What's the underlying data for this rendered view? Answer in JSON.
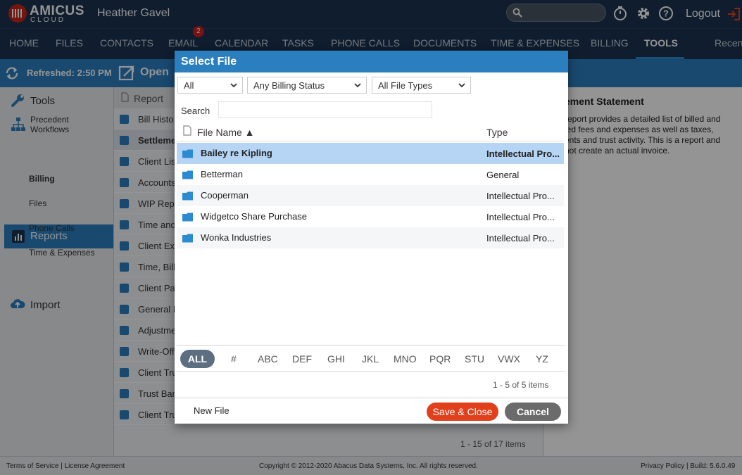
{
  "header": {
    "logo_main": "AMICUS",
    "logo_sub": "CLOUD",
    "user_name": "Heather Gavel",
    "logout_label": "Logout"
  },
  "nav": {
    "items": [
      "HOME",
      "FILES",
      "CONTACTS",
      "EMAIL",
      "CALENDAR",
      "TASKS",
      "PHONE CALLS",
      "DOCUMENTS",
      "TIME & EXPENSES",
      "BILLING",
      "TOOLS",
      "Recen"
    ],
    "active": "TOOLS",
    "email_badge": "2"
  },
  "subbar": {
    "refreshed": "Refreshed: 2:50 PM",
    "open_label": "Open"
  },
  "sidebar": {
    "tools": "Tools",
    "precedent_workflows": "Precedent Workflows",
    "reports": "Reports",
    "sub_items": [
      "Billing",
      "Files",
      "Phone Calls",
      "Time & Expenses"
    ],
    "import": "Import"
  },
  "report_list": {
    "header": "Report",
    "rows": [
      "Bill Histo",
      "Settleme",
      "Client Lis",
      "Accounts",
      "WIP Repo",
      "Time and",
      "Client Exp",
      "Time, Bill",
      "Client Pa",
      "General E",
      "Adjustme",
      "Write-Off",
      "Client Tru",
      "Trust Bar",
      "Client Tru"
    ],
    "footer": "1 - 15 of 17 items"
  },
  "detail": {
    "title": "ement Statement",
    "lines": [
      "report provides a detailed list of billed and",
      "led fees and expenses as well as taxes,",
      "ents and trust activity.  This is a report and",
      "not create an actual invoice."
    ]
  },
  "footer": {
    "left": "Terms of Service | License Agreement",
    "center": "Copyright © 2012-2020 Abacus Data Systems, Inc. All rights reserved.",
    "right": "Privacy Policy | Build: 5.6.0.49"
  },
  "modal": {
    "title": "Select File",
    "filters": [
      "All",
      "Any Billing Status",
      "All File Types"
    ],
    "search_label": "Search",
    "search_value": "",
    "col_name": "File Name ▲",
    "col_type": "Type",
    "files": [
      {
        "name": "Bailey re Kipling",
        "type": "Intellectual Pro..."
      },
      {
        "name": "Betterman",
        "type": "General"
      },
      {
        "name": "Cooperman",
        "type": "Intellectual Pro..."
      },
      {
        "name": "Widgetco Share Purchase",
        "type": "Intellectual Pro..."
      },
      {
        "name": "Wonka Industries",
        "type": "Intellectual Pro..."
      }
    ],
    "alpha": [
      "ALL",
      "#",
      "ABC",
      "DEF",
      "GHI",
      "JKL",
      "MNO",
      "PQR",
      "STU",
      "VWX",
      "YZ"
    ],
    "items_count": "1 - 5 of 5 items",
    "new_file": "New File",
    "save_close": "Save & Close",
    "cancel": "Cancel"
  }
}
